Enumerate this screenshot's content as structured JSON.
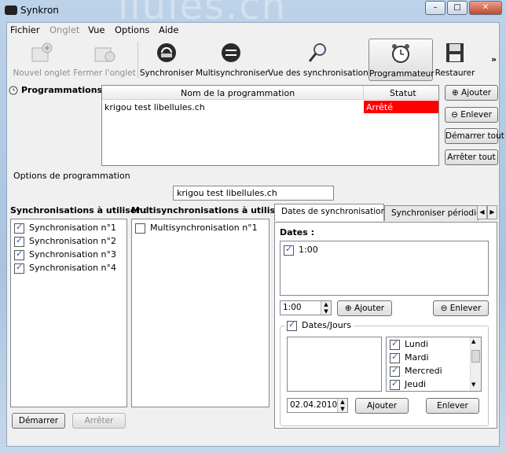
{
  "window": {
    "title": "Synkron"
  },
  "menu": {
    "items": [
      "Fichier",
      "Onglet",
      "Vue",
      "Options",
      "Aide"
    ]
  },
  "toolbar": {
    "new_tab": "Nouvel onglet",
    "close_tab": "Fermer l'onglet",
    "sync": "Synchroniser",
    "multisync": "Multisynchroniser",
    "view_syncs": "Vue des synchronisations",
    "scheduler": "Programmateur",
    "restore": "Restaurer",
    "more": "»"
  },
  "schedules": {
    "label": "Programmations :",
    "col_name": "Nom de la programmation",
    "col_status": "Statut",
    "rows": [
      {
        "name": "krigou test libellules.ch",
        "status": "Arrêté",
        "status_color": "#ff0000"
      }
    ],
    "add": "Ajouter",
    "remove": "Enlever",
    "start_all": "Démarrer tout",
    "stop_all": "Arrêter tout"
  },
  "options": {
    "label": "Options de programmation",
    "name_value": "krigou test libellules.ch"
  },
  "syncs": {
    "label": "Synchronisations à utiliser :",
    "items": [
      {
        "label": "Synchronisation n°1",
        "checked": true
      },
      {
        "label": "Synchronisation n°2",
        "checked": true
      },
      {
        "label": "Synchronisation n°3",
        "checked": true
      },
      {
        "label": "Synchronisation n°4",
        "checked": true
      }
    ]
  },
  "multisyncs": {
    "label": "Multisynchronisations à utiliser :",
    "items": [
      {
        "label": "Multisynchronisation n°1",
        "checked": false
      }
    ]
  },
  "tabs": {
    "dates": "Dates de synchronisation",
    "periodic": "Synchroniser périodiqu",
    "dates_label": "Dates :",
    "time_list": [
      {
        "label": "1:00",
        "checked": true
      }
    ],
    "time_value": "1:00",
    "add": "Ajouter",
    "remove": "Enlever",
    "dates_days": "Dates/Jours",
    "days": [
      {
        "label": "Lundi",
        "checked": true
      },
      {
        "label": "Mardi",
        "checked": true
      },
      {
        "label": "Mercredi",
        "checked": true
      },
      {
        "label": "Jeudi",
        "checked": true
      }
    ],
    "date_value": "02.04.2010",
    "add2": "Ajouter",
    "remove2": "Enlever"
  },
  "bottom": {
    "start": "Démarrer",
    "stop": "Arrêter"
  }
}
